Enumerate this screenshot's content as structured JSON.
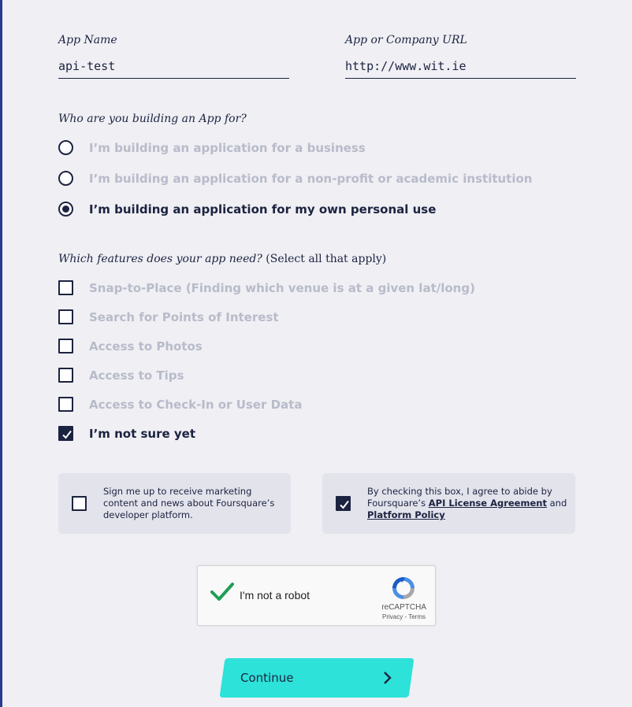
{
  "app_name": {
    "label": "App Name",
    "value": "api-test"
  },
  "app_url": {
    "label": "App or Company URL",
    "value": "http://www.wit.ie"
  },
  "audience": {
    "question": "Who are you building an App for?",
    "options": [
      "I’m building an application for a business",
      "I’m building an application for a non-profit or academic institution",
      "I’m building an application for my own personal use"
    ],
    "selected_index": 2
  },
  "features": {
    "question": "Which features does your app need?",
    "question_note": "(Select all that apply)",
    "options": [
      "Snap-to-Place (Finding which venue is at a given lat/long)",
      "Search for Points of Interest",
      "Access to Photos",
      "Access to Tips",
      "Access to Check-In or User Data",
      "I’m not sure yet"
    ],
    "checked": [
      false,
      false,
      false,
      false,
      false,
      true
    ]
  },
  "marketing": {
    "text": "Sign me up to receive marketing content and news about Foursquare’s developer platform.",
    "checked": false
  },
  "agreement": {
    "text_before": "By checking this box, I agree to abide by Foursquare’s ",
    "link1": "API License Agreement",
    "text_mid": " and ",
    "link2": "Platform Policy",
    "checked": true
  },
  "captcha": {
    "label": "I'm not a robot",
    "brand": "reCAPTCHA",
    "privacy": "Privacy",
    "separator": " - ",
    "terms": "Terms",
    "verified": true
  },
  "continue_button": {
    "label": "Continue"
  },
  "colors": {
    "navy": "#1c2340",
    "teal": "#2de2d8",
    "muted": "#b8bbc9",
    "check_green": "#1e9e57"
  }
}
